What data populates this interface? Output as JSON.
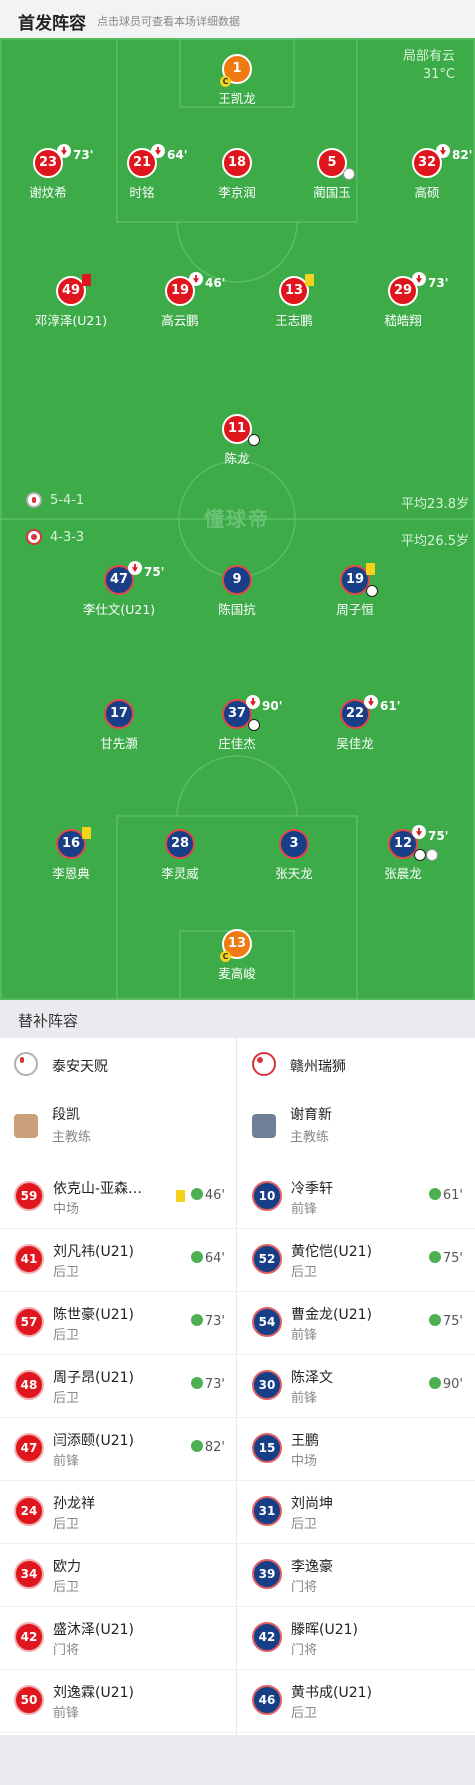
{
  "header": {
    "title": "首发阵容",
    "subtitle": "点击球员可查看本场详细数据"
  },
  "weather": {
    "line1": "局部有云",
    "line2": "31°C"
  },
  "watermark": "懂球帝",
  "home": {
    "formation": "5-4-1",
    "avg": "平均23.8岁"
  },
  "away": {
    "formation": "4-3-3",
    "avg": "平均26.5岁"
  },
  "players": [
    {
      "num": "1",
      "name": "王凯龙",
      "kind": "o",
      "cap": "C"
    },
    {
      "num": "23",
      "name": "谢炆希",
      "kind": "r",
      "sub": "73'"
    },
    {
      "num": "21",
      "name": "时铭",
      "kind": "r",
      "sub": "64'"
    },
    {
      "num": "18",
      "name": "李京润",
      "kind": "r"
    },
    {
      "num": "5",
      "name": "蔺国玉",
      "kind": "r"
    },
    {
      "num": "32",
      "name": "高硕",
      "kind": "r",
      "sub": "82'"
    },
    {
      "num": "49",
      "name": "邓淳泽(U21)",
      "kind": "r"
    },
    {
      "num": "19",
      "name": "高云鹏",
      "kind": "r",
      "sub": "46'"
    },
    {
      "num": "13",
      "name": "王志鹏",
      "kind": "r"
    },
    {
      "num": "29",
      "name": "嵇皓翔",
      "kind": "r",
      "sub": "73'"
    },
    {
      "num": "11",
      "name": "陈龙",
      "kind": "r"
    },
    {
      "num": "47",
      "name": "李仕文(U21)",
      "kind": "b",
      "sub": "75'"
    },
    {
      "num": "9",
      "name": "陈国抗",
      "kind": "b"
    },
    {
      "num": "19",
      "name": "周子恒",
      "kind": "b"
    },
    {
      "num": "17",
      "name": "甘先灏",
      "kind": "b"
    },
    {
      "num": "37",
      "name": "庄佳杰",
      "kind": "b",
      "sub": "90'"
    },
    {
      "num": "22",
      "name": "吴佳龙",
      "kind": "b",
      "sub": "61'"
    },
    {
      "num": "16",
      "name": "李恩典",
      "kind": "b"
    },
    {
      "num": "28",
      "name": "李灵威",
      "kind": "b"
    },
    {
      "num": "3",
      "name": "张天龙",
      "kind": "b"
    },
    {
      "num": "12",
      "name": "张晨龙",
      "kind": "b",
      "sub": "75'"
    },
    {
      "num": "13",
      "name": "麦高峻",
      "kind": "o",
      "cap": "C"
    }
  ],
  "subs_header": "替补阵容",
  "left": {
    "team": "泰安天贶",
    "coach": {
      "name": "段凯",
      "role": "主教练"
    },
    "rows": [
      {
        "num": "59",
        "name": "依克山-亚森…",
        "pos": "中场",
        "in": "46'",
        "yc": true
      },
      {
        "num": "41",
        "name": "刘凡祎(U21)",
        "pos": "后卫",
        "in": "64'"
      },
      {
        "num": "57",
        "name": "陈世豪(U21)",
        "pos": "后卫",
        "in": "73'"
      },
      {
        "num": "48",
        "name": "周子昂(U21)",
        "pos": "后卫",
        "in": "73'"
      },
      {
        "num": "47",
        "name": "闫添颐(U21)",
        "pos": "前锋",
        "in": "82'"
      },
      {
        "num": "24",
        "name": "孙龙祥",
        "pos": "后卫",
        "in": ""
      },
      {
        "num": "34",
        "name": "欧力",
        "pos": "后卫",
        "in": ""
      },
      {
        "num": "42",
        "name": "盛沐泽(U21)",
        "pos": "门将",
        "in": ""
      },
      {
        "num": "50",
        "name": "刘逸霖(U21)",
        "pos": "前锋",
        "in": ""
      }
    ]
  },
  "right": {
    "team": "赣州瑞狮",
    "coach": {
      "name": "谢育新",
      "role": "主教练"
    },
    "rows": [
      {
        "num": "10",
        "name": "冷季轩",
        "pos": "前锋",
        "in": "61'"
      },
      {
        "num": "52",
        "name": "黄佗恺(U21)",
        "pos": "后卫",
        "in": "75'"
      },
      {
        "num": "54",
        "name": "曹金龙(U21)",
        "pos": "前锋",
        "in": "75'"
      },
      {
        "num": "30",
        "name": "陈泽文",
        "pos": "前锋",
        "in": "90'"
      },
      {
        "num": "15",
        "name": "王鹏",
        "pos": "中场",
        "in": ""
      },
      {
        "num": "31",
        "name": "刘尚坤",
        "pos": "后卫",
        "in": ""
      },
      {
        "num": "39",
        "name": "李逸豪",
        "pos": "门将",
        "in": ""
      },
      {
        "num": "42",
        "name": "滕晖(U21)",
        "pos": "门将",
        "in": ""
      },
      {
        "num": "46",
        "name": "黄书成(U21)",
        "pos": "后卫",
        "in": ""
      }
    ]
  }
}
